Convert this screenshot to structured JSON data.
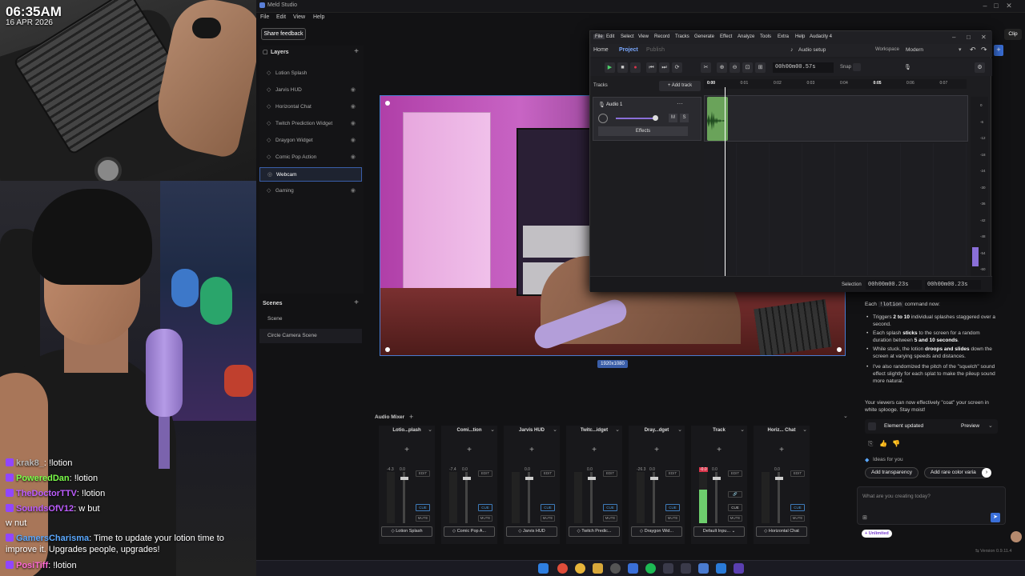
{
  "stream": {
    "clock_time": "06:35AM",
    "clock_date": "16 APR 2026",
    "chat": [
      {
        "name": "krak8_",
        "name_color": "#b8b8b8",
        "text": ": !lotion"
      },
      {
        "name": "PoweredDan",
        "name_color": "#7cff4a",
        "text": ": !lotion"
      },
      {
        "name": "TheDoctorTTV",
        "name_color": "#bd5cff",
        "text": ": !lotion"
      },
      {
        "name": "SoundsOfV12",
        "name_color": "#bd5cff",
        "text": ": w but"
      },
      {
        "name": "",
        "name_color": "#ffffff",
        "text": "w nut"
      },
      {
        "name": "GamersCharisma",
        "name_color": "#5aa8ff",
        "text": ": Time to update your lotion time to improve it. Upgrades people, upgrades!"
      },
      {
        "name": "PosiTiff",
        "name_color": "#ff6ad5",
        "text": ": !lotion"
      }
    ]
  },
  "app": {
    "title": "Meld Studio",
    "menu": [
      "File",
      "Edit",
      "View",
      "Help"
    ],
    "share_feedback": "Share feedback",
    "clip_label": "Clip",
    "layers_title": "Layers",
    "layers": [
      {
        "label": "Lotion Splash",
        "icon": "◇"
      },
      {
        "label": "Jarvis HUD",
        "icon": "◇"
      },
      {
        "label": "Horizontal Chat",
        "icon": "◇"
      },
      {
        "label": "Twitch Prediction Widget",
        "icon": "◇"
      },
      {
        "label": "Draygon Widget",
        "icon": "◇"
      },
      {
        "label": "Comic Pop Action",
        "icon": "◇"
      },
      {
        "label": "Webcam",
        "icon": "◎",
        "selected": true
      },
      {
        "label": "Gaming",
        "icon": "◇"
      }
    ],
    "scenes_title": "Scenes",
    "scenes": [
      {
        "label": "Scene"
      },
      {
        "label": "Circle Camera Scene",
        "selected": true
      }
    ],
    "resolution": "1920x1080",
    "mixer_title": "Audio Mixer",
    "channels": [
      {
        "name": "Lotio...plash",
        "source": "Lotion Splash",
        "db": "-4.3",
        "fader": "0.0",
        "level": 0.0
      },
      {
        "name": "Comi...tion",
        "source": "Comic Pop A...",
        "db": "-7.4",
        "fader": "0.0",
        "level": 0.0
      },
      {
        "name": "Jarvis HUD",
        "source": "Jarvis HUD",
        "db": "",
        "fader": "0.0",
        "level": 0.0
      },
      {
        "name": "Twitc...idget",
        "source": "Twitch Predic...",
        "db": "",
        "fader": "0.0",
        "level": 0.0
      },
      {
        "name": "Dray...dget",
        "source": "Draygon Wid...",
        "db": "-26.3",
        "fader": "0.0",
        "level": 0.0
      },
      {
        "name": "Track",
        "source": "Default Inpu...",
        "db": "-0.0",
        "fader": "0.0",
        "level": 0.65
      },
      {
        "name": "Horiz... Chat",
        "source": "Horizontal Chat",
        "db": "",
        "fader": "0.0",
        "level": 0.0
      }
    ],
    "edit_label": "EDIT",
    "cue_label": "CUE",
    "mute_label": "MUTE",
    "version": "Version 0.9.11.4"
  },
  "audacity": {
    "menu": [
      "File",
      "Edit",
      "Select",
      "View",
      "Record",
      "Tracks",
      "Generate",
      "Effect",
      "Analyze",
      "Tools",
      "Extra",
      "Help",
      "Audacity 4"
    ],
    "tabs": [
      "Home",
      "Project",
      "Publish"
    ],
    "audio_setup": "Audio setup",
    "workspace_label": "Workspace",
    "workspace_value": "Modern",
    "time": "00h00m00.57s",
    "snap_label": "Snap",
    "tracks_label": "Tracks",
    "add_track": "Add track",
    "track_name": "Audio 1",
    "effects_label": "Effects",
    "mute": "M",
    "solo": "S",
    "ruler": [
      "0:00",
      "0:01",
      "0:02",
      "0:03",
      "0:04",
      "0:05",
      "0:06",
      "0:07"
    ],
    "vu_ticks": [
      "0",
      "-6",
      "-12",
      "-18",
      "-24",
      "-30",
      "-36",
      "-42",
      "-48",
      "-54",
      "-60"
    ],
    "selection_label": "Selection",
    "selection_start": "00h00m00.23s",
    "selection_end": "00h00m00.23s"
  },
  "ai_panel": {
    "intro": "Each ",
    "command": "!lotion",
    "intro_end": " command now:",
    "bullets": [
      {
        "a": "Triggers ",
        "b": "2 to 10",
        "c": " individual splashes staggered over a second."
      },
      {
        "a": "Each splash ",
        "b": "sticks",
        "c": " to the screen for a random duration between ",
        "d": "5 and 10 seconds",
        "e": "."
      },
      {
        "a": "While stuck, the lotion ",
        "b": "droops and slides",
        "c": " down the screen at varying speeds and distances."
      },
      {
        "a": "I've also randomized the pitch of the \"squelch\" sound effect slightly for each splat to make the pileup sound more natural.",
        "b": "",
        "c": ""
      }
    ],
    "outro": "Your viewers can now effectively \"coat\" your screen in white sploogе. Stay moist!",
    "element_updated": "Element updated",
    "preview": "Preview",
    "ideas_label": "Ideas for you",
    "idea1": "Add transparency",
    "idea2": "Add rare color varia",
    "input_placeholder": "What are you creating today?",
    "unlimited": "+ Unlimited"
  },
  "colors": {
    "accent": "#3a5ea8",
    "selected_border": "#4a7bd0",
    "meter_green": "#6dce6d",
    "record_red": "#d9344a"
  }
}
